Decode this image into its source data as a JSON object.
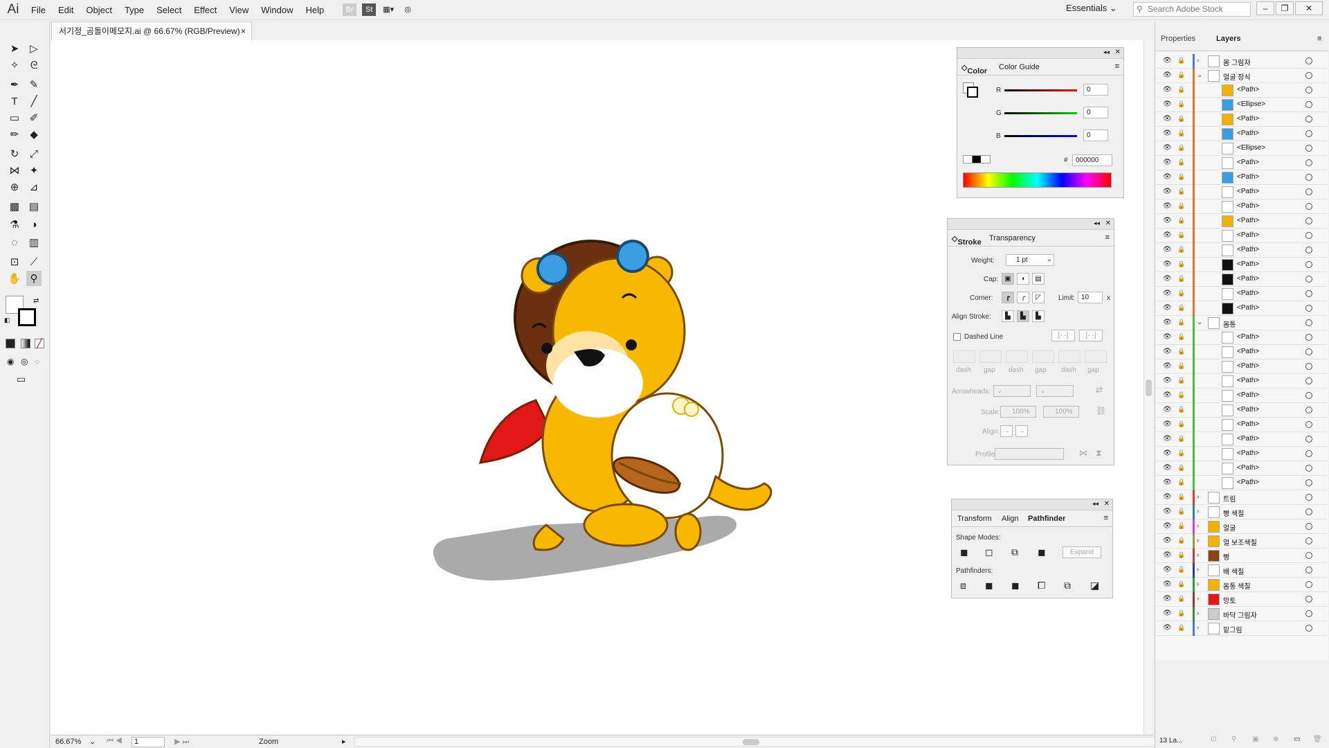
{
  "app": {
    "logo": "Ai",
    "menus": [
      "File",
      "Edit",
      "Object",
      "Type",
      "Select",
      "Effect",
      "View",
      "Window",
      "Help"
    ],
    "bridge": "Br",
    "stock": "St",
    "workspace": "Essentials",
    "search_placeholder": "Search Adobe Stock"
  },
  "document": {
    "tab_title": "서기정_곰돌이메모지.ai @ 66.67% (RGB/Preview)",
    "close": "×"
  },
  "status": {
    "zoom": "66.67%",
    "artboard": "1",
    "tool": "Zoom"
  },
  "color_panel": {
    "tabs": [
      "Color",
      "Color Guide"
    ],
    "r_label": "R",
    "r_value": "0",
    "g_label": "G",
    "g_value": "0",
    "b_label": "B",
    "b_value": "0",
    "hex_label": "#",
    "hex_value": "000000"
  },
  "stroke_panel": {
    "tabs": [
      "Stroke",
      "Transparency"
    ],
    "weight_label": "Weight:",
    "weight_value": "1 pt",
    "cap_label": "Cap:",
    "corner_label": "Corner:",
    "limit_label": "Limit:",
    "limit_value": "10",
    "limit_unit": "x",
    "align_label": "Align Stroke:",
    "dashed_label": "Dashed Line",
    "dash_labels": [
      "dash",
      "gap",
      "dash",
      "gap",
      "dash",
      "gap"
    ],
    "arrowheads_label": "Arrowheads:",
    "scale_label": "Scale:",
    "scale_1": "100%",
    "scale_2": "100%",
    "align2_label": "Align:",
    "profile_label": "Profile:"
  },
  "pathfinder_panel": {
    "tabs": [
      "Transform",
      "Align",
      "Pathfinder"
    ],
    "shape_modes_label": "Shape Modes:",
    "expand_label": "Expand",
    "pathfinders_label": "Pathfinders:"
  },
  "right_tabs": [
    "Properties",
    "Layers"
  ],
  "layers": [
    {
      "name": "몸 그림자",
      "indent": 0,
      "color": "#4a7bd0",
      "expander": "›",
      "thumb": "#ffffff"
    },
    {
      "name": "얼굴 장식",
      "indent": 0,
      "color": "#e07a2a",
      "expander": "⌄",
      "thumb": "#ffffff"
    },
    {
      "name": "<Path>",
      "indent": 1,
      "color": "#e07a2a",
      "expander": "",
      "thumb": "#f5b000"
    },
    {
      "name": "<Ellipse>",
      "indent": 1,
      "color": "#e07a2a",
      "expander": "",
      "thumb": "#3a9ee0"
    },
    {
      "name": "<Path>",
      "indent": 1,
      "color": "#e07a2a",
      "expander": "",
      "thumb": "#f5b000"
    },
    {
      "name": "<Path>",
      "indent": 1,
      "color": "#e07a2a",
      "expander": "",
      "thumb": "#3a9ee0"
    },
    {
      "name": "<Ellipse>",
      "indent": 1,
      "color": "#e07a2a",
      "expander": "",
      "thumb": "#ffffff"
    },
    {
      "name": "<Path>",
      "indent": 1,
      "color": "#e07a2a",
      "expander": "",
      "thumb": "#ffffff"
    },
    {
      "name": "<Path>",
      "indent": 1,
      "color": "#e07a2a",
      "expander": "",
      "thumb": "#3a9ee0"
    },
    {
      "name": "<Path>",
      "indent": 1,
      "color": "#e07a2a",
      "expander": "",
      "thumb": "#ffffff"
    },
    {
      "name": "<Path>",
      "indent": 1,
      "color": "#e07a2a",
      "expander": "",
      "thumb": "#ffffff"
    },
    {
      "name": "<Path>",
      "indent": 1,
      "color": "#e07a2a",
      "expander": "",
      "thumb": "#f5b000"
    },
    {
      "name": "<Path>",
      "indent": 1,
      "color": "#e07a2a",
      "expander": "",
      "thumb": "#ffffff"
    },
    {
      "name": "<Path>",
      "indent": 1,
      "color": "#e07a2a",
      "expander": "",
      "thumb": "#ffffff"
    },
    {
      "name": "<Path>",
      "indent": 1,
      "color": "#e07a2a",
      "expander": "",
      "thumb": "#111111"
    },
    {
      "name": "<Path>",
      "indent": 1,
      "color": "#e07a2a",
      "expander": "",
      "thumb": "#111111"
    },
    {
      "name": "<Path>",
      "indent": 1,
      "color": "#e07a2a",
      "expander": "",
      "thumb": "#ffffff"
    },
    {
      "name": "<Path>",
      "indent": 1,
      "color": "#e07a2a",
      "expander": "",
      "thumb": "#111111"
    },
    {
      "name": "몸통",
      "indent": 0,
      "color": "#43c443",
      "expander": "⌄",
      "thumb": "#ffffff"
    },
    {
      "name": "<Path>",
      "indent": 1,
      "color": "#43c443",
      "expander": "",
      "thumb": "#ffffff"
    },
    {
      "name": "<Path>",
      "indent": 1,
      "color": "#43c443",
      "expander": "",
      "thumb": "#ffffff"
    },
    {
      "name": "<Path>",
      "indent": 1,
      "color": "#43c443",
      "expander": "",
      "thumb": "#ffffff"
    },
    {
      "name": "<Path>",
      "indent": 1,
      "color": "#43c443",
      "expander": "",
      "thumb": "#ffffff"
    },
    {
      "name": "<Path>",
      "indent": 1,
      "color": "#43c443",
      "expander": "",
      "thumb": "#ffffff"
    },
    {
      "name": "<Path>",
      "indent": 1,
      "color": "#43c443",
      "expander": "",
      "thumb": "#ffffff"
    },
    {
      "name": "<Path>",
      "indent": 1,
      "color": "#43c443",
      "expander": "",
      "thumb": "#ffffff"
    },
    {
      "name": "<Path>",
      "indent": 1,
      "color": "#43c443",
      "expander": "",
      "thumb": "#ffffff"
    },
    {
      "name": "<Path>",
      "indent": 1,
      "color": "#43c443",
      "expander": "",
      "thumb": "#ffffff"
    },
    {
      "name": "<Path>",
      "indent": 1,
      "color": "#43c443",
      "expander": "",
      "thumb": "#ffffff"
    },
    {
      "name": "<Path>",
      "indent": 1,
      "color": "#43c443",
      "expander": "",
      "thumb": "#ffffff"
    },
    {
      "name": "트림",
      "indent": 0,
      "color": "#e03a3a",
      "expander": "›",
      "thumb": "#ffffff"
    },
    {
      "name": "빵 색칠",
      "indent": 0,
      "color": "#2a8a8a",
      "expander": "›",
      "thumb": "#ffffff"
    },
    {
      "name": "얼굴",
      "indent": 0,
      "color": "#e040e0",
      "expander": "›",
      "thumb": "#f5b000"
    },
    {
      "name": "얼 보조색칠",
      "indent": 0,
      "color": "#9a9a3a",
      "expander": "›",
      "thumb": "#f5b000"
    },
    {
      "name": "빵",
      "indent": 0,
      "color": "#c04040",
      "expander": "›",
      "thumb": "#8b4513"
    },
    {
      "name": "배 색칠",
      "indent": 0,
      "color": "#3a3a9a",
      "expander": "›",
      "thumb": "#ffffff"
    },
    {
      "name": "몸통 색칠",
      "indent": 0,
      "color": "#3a9a3a",
      "expander": "›",
      "thumb": "#f5b000"
    },
    {
      "name": "망토",
      "indent": 0,
      "color": "#8a3a3a",
      "expander": "›",
      "thumb": "#e01818"
    },
    {
      "name": "바닥 그림자",
      "indent": 0,
      "color": "#3a8a3a",
      "expander": "›",
      "thumb": "#cccccc"
    },
    {
      "name": "밑그림",
      "indent": 0,
      "color": "#4a7bd0",
      "expander": "›",
      "thumb": "#ffffff"
    }
  ],
  "layers_footer": {
    "count": "13 La..."
  },
  "colors": {
    "bear_fill": "#f8b800",
    "bear_outline": "#7a4a00",
    "helmet": "#6b3010",
    "goggles": "#3a9ee0",
    "cape": "#e01818",
    "shadow": "#aaaaaa"
  }
}
